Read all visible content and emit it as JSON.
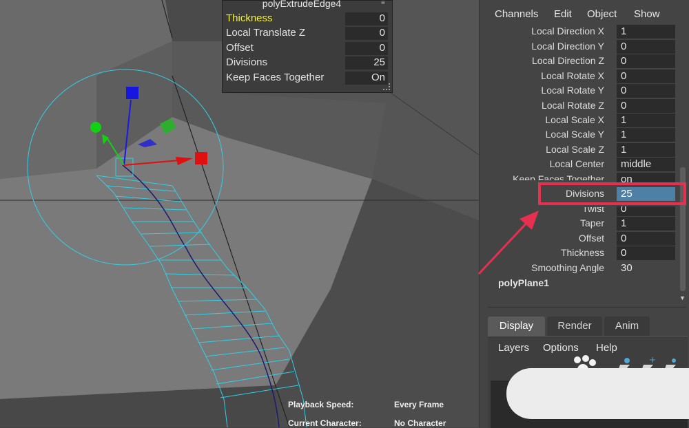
{
  "hud": {
    "title": "polyExtrudeEdge4",
    "rows": [
      {
        "label": "Thickness",
        "value": "0"
      },
      {
        "label": "Local Translate Z",
        "value": "0"
      },
      {
        "label": "Offset",
        "value": "0"
      },
      {
        "label": "Divisions",
        "value": "25"
      },
      {
        "label": "Keep Faces Together",
        "value": "On"
      }
    ]
  },
  "status": {
    "playback_label": "Playback Speed:",
    "playback_value": "Every Frame",
    "character_label": "Current Character:",
    "character_value": "No Character"
  },
  "channel_box": {
    "menu": [
      "Channels",
      "Edit",
      "Object",
      "Show"
    ],
    "attributes": [
      {
        "label": "Local Direction X",
        "value": "1"
      },
      {
        "label": "Local Direction Y",
        "value": "0"
      },
      {
        "label": "Local Direction Z",
        "value": "0"
      },
      {
        "label": "Local Rotate X",
        "value": "0"
      },
      {
        "label": "Local Rotate Y",
        "value": "0"
      },
      {
        "label": "Local Rotate Z",
        "value": "0"
      },
      {
        "label": "Local Scale X",
        "value": "1"
      },
      {
        "label": "Local Scale Y",
        "value": "1"
      },
      {
        "label": "Local Scale Z",
        "value": "1"
      },
      {
        "label": "Local Center",
        "value": "middle"
      },
      {
        "label": "Keep Faces Together",
        "value": "on"
      },
      {
        "label": "Divisions",
        "value": "25"
      },
      {
        "label": "Twist",
        "value": "0"
      },
      {
        "label": "Taper",
        "value": "1"
      },
      {
        "label": "Offset",
        "value": "0"
      },
      {
        "label": "Thickness",
        "value": "0"
      },
      {
        "label": "Smoothing Angle",
        "value": "30"
      }
    ],
    "node": "polyPlane1",
    "highlight_color": "#e6304f"
  },
  "layer_editor": {
    "tabs": [
      "Display",
      "Render",
      "Anim"
    ],
    "active_tab": "Display",
    "menu": [
      "Layers",
      "Options",
      "Help"
    ],
    "icons": [
      "paint-icon",
      "new-layer-icon",
      "add-selected-icon",
      "remove-icon"
    ]
  },
  "colors": {
    "manip_x": "#e01010",
    "manip_y": "#10d010",
    "manip_z": "#1010e0",
    "wire": "#30d0e8",
    "hud_highlight": "#f5f03a",
    "selected_field": "#4e7fa4"
  }
}
